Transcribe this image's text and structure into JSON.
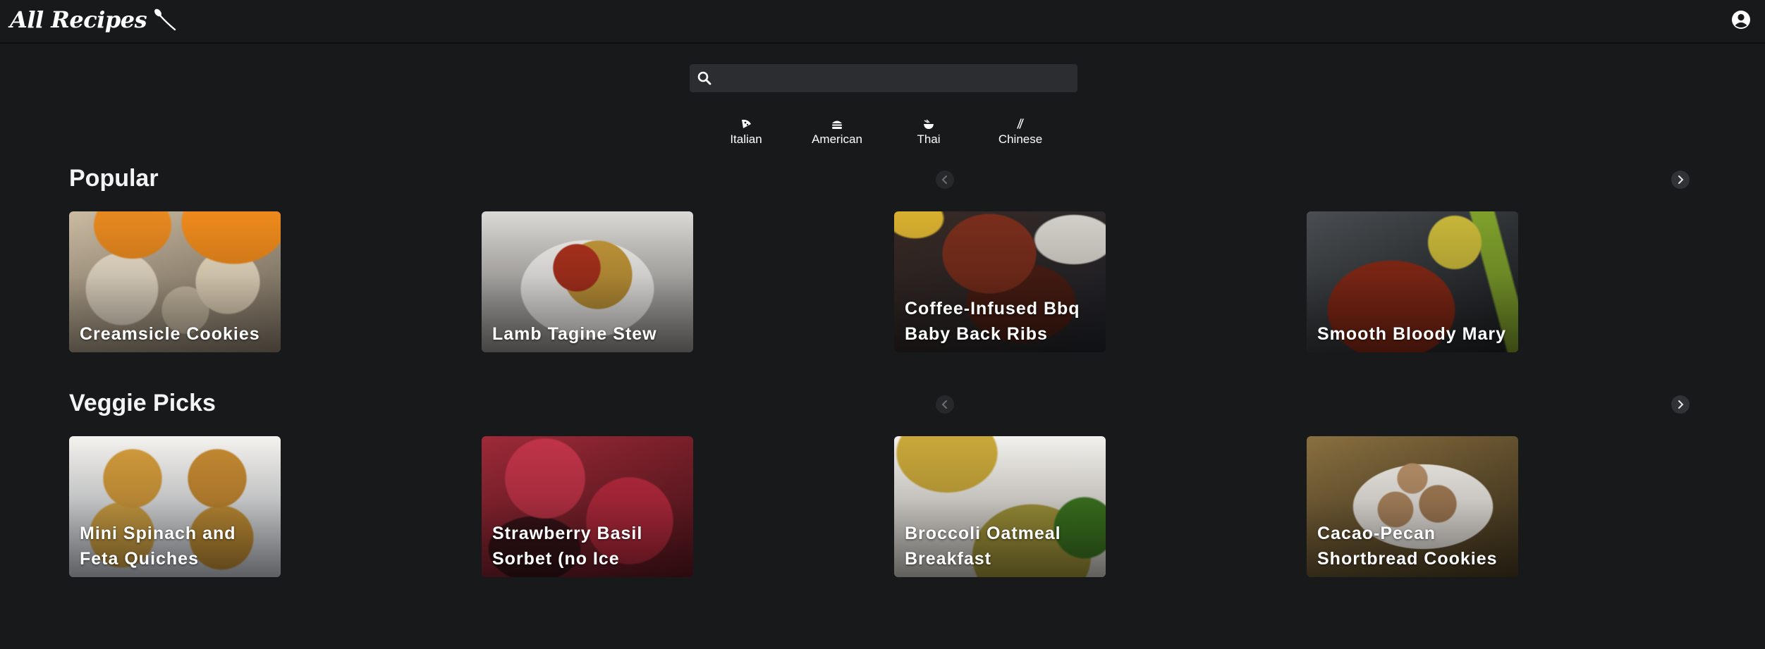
{
  "header": {
    "logo_text": "All Recipes",
    "logo_icon": "spoon-icon",
    "user_icon": "user-circle-icon"
  },
  "search": {
    "placeholder": "",
    "value": "",
    "icon": "search-icon"
  },
  "cuisines": [
    {
      "label": "Italian",
      "icon": "pizza-icon"
    },
    {
      "label": "American",
      "icon": "burger-icon"
    },
    {
      "label": "Thai",
      "icon": "noodle-bowl-icon"
    },
    {
      "label": "Chinese",
      "icon": "chopsticks-icon"
    }
  ],
  "sections": [
    {
      "title": "Popular",
      "cards": [
        {
          "title": "Creamsicle Cookies"
        },
        {
          "title": "Lamb Tagine Stew"
        },
        {
          "title": "Coffee-Infused Bbq Baby Back Ribs"
        },
        {
          "title": "Smooth Bloody Mary"
        }
      ]
    },
    {
      "title": "Veggie Picks",
      "cards": [
        {
          "title": "Mini Spinach and Feta Quiches"
        },
        {
          "title": "Strawberry Basil Sorbet (no Ice"
        },
        {
          "title": "Broccoli Oatmeal Breakfast"
        },
        {
          "title": "Cacao-Pecan Shortbread Cookies"
        }
      ]
    }
  ],
  "colors": {
    "background": "#18191b",
    "search_bg": "#2b2d30",
    "text": "#ffffff"
  }
}
